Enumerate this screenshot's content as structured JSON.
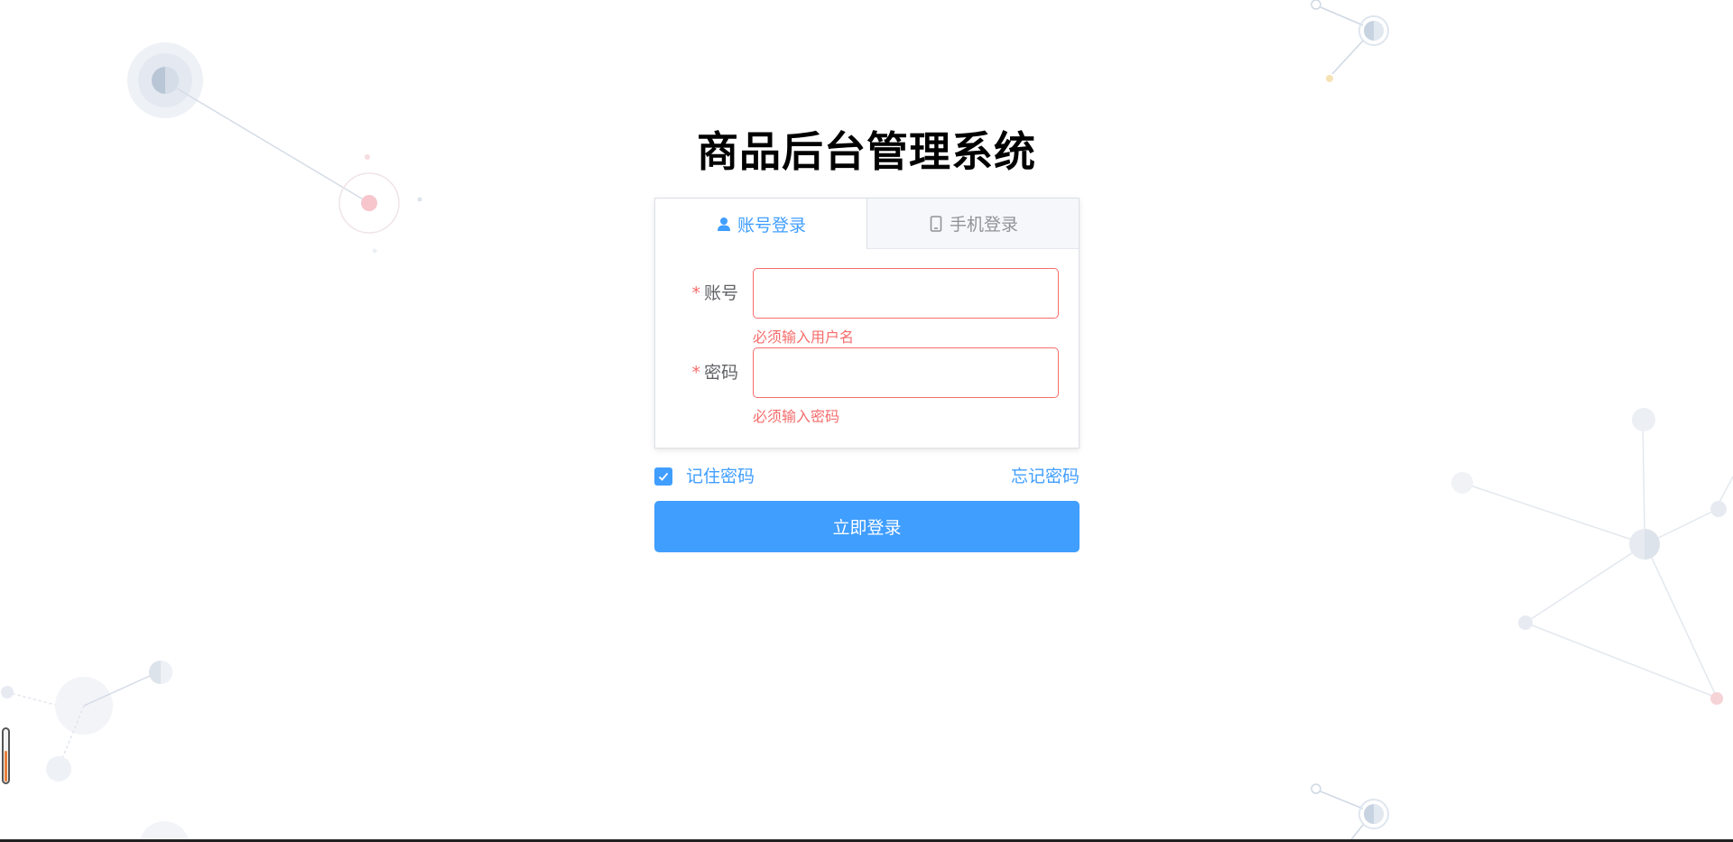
{
  "app": {
    "title": "商品后台管理系统"
  },
  "tabs": [
    {
      "label": "账号登录",
      "icon": "user-icon",
      "active": true
    },
    {
      "label": "手机登录",
      "icon": "mobile-phone-icon",
      "active": false
    }
  ],
  "form": {
    "account": {
      "required_mark": "*",
      "label": "账号",
      "value": "",
      "error": "必须输入用户名"
    },
    "password": {
      "required_mark": "*",
      "label": "密码",
      "value": "",
      "error": "必须输入密码"
    }
  },
  "options": {
    "remember_label": "记住密码",
    "remember_checked": true,
    "forgot_label": "忘记密码"
  },
  "submit": {
    "label": "立即登录"
  },
  "colors": {
    "accent": "#409eff",
    "error": "#f56c6c",
    "label": "#606266",
    "inactive_tab": "#909399"
  }
}
